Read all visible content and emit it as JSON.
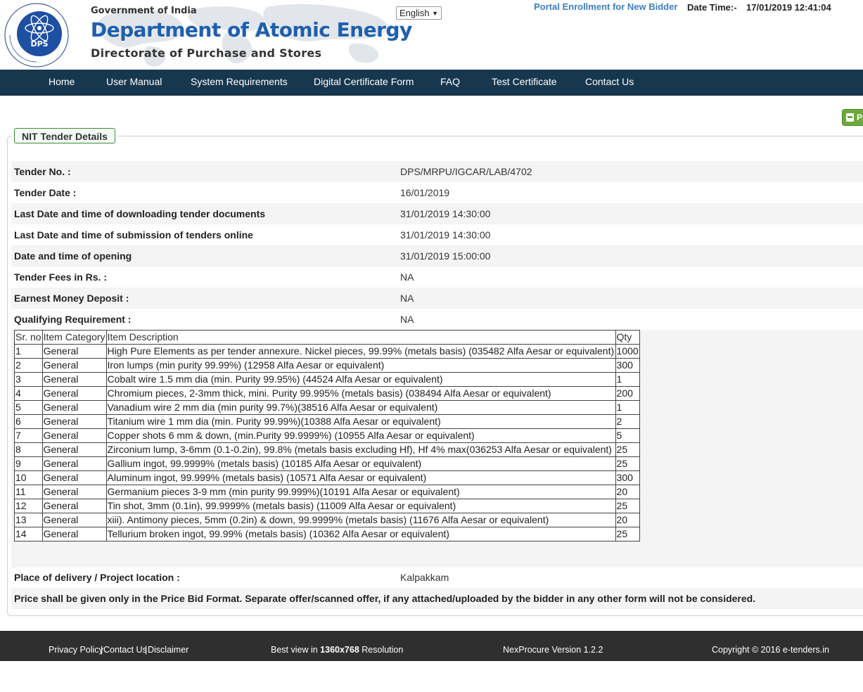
{
  "header": {
    "gov_text": "Government of India",
    "dept_title": "Department of Atomic Energy",
    "dept_subtitle": "Directorate of Purchase and Stores",
    "logo_text": "DPS",
    "language": "English",
    "portal_link": "Portal Enrollment for New Bidder",
    "datetime_label": "Date Time:-",
    "datetime_value": "17/01/2019 12:41:04"
  },
  "nav": {
    "items": [
      "Home",
      "User Manual",
      "System Requirements",
      "Digital Certificate Form",
      "FAQ",
      "Test Certificate",
      "Contact Us"
    ]
  },
  "print_button": "Pr",
  "panel": {
    "legend": "NIT Tender Details",
    "fields": [
      {
        "label": "Tender No. :",
        "value": "DPS/MRPU/IGCAR/LAB/4702"
      },
      {
        "label": "Tender Date :",
        "value": "16/01/2019"
      },
      {
        "label": "Last Date and time of downloading tender documents",
        "value": "31/01/2019 14:30:00"
      },
      {
        "label": "Last Date and time of submission of tenders online",
        "value": "31/01/2019 14:30:00"
      },
      {
        "label": "Date and time of opening",
        "value": "31/01/2019 15:00:00"
      },
      {
        "label": "Tender Fees in Rs. :",
        "value": "NA"
      },
      {
        "label": "Earnest Money Deposit :",
        "value": "NA"
      },
      {
        "label": "Qualifying Requirement :",
        "value": "NA"
      }
    ],
    "items_table": {
      "headers": [
        "Sr. no",
        "Item Category",
        "Item Description",
        "Qty"
      ],
      "rows": [
        [
          "1",
          "General",
          "High Pure Elements as per tender annexure. Nickel pieces, 99.99% (metals basis) (035482 Alfa Aesar or equivalent)",
          "1000"
        ],
        [
          "2",
          "General",
          "Iron lumps (min purity 99.99%) (12958 Alfa Aesar or equivalent)",
          "300"
        ],
        [
          "3",
          "General",
          "Cobalt wire 1.5 mm dia (min. Purity 99.95%) (44524 Alfa Aesar or equivalent)",
          "1"
        ],
        [
          "4",
          "General",
          "Chromium pieces, 2-3mm thick, mini. Purity 99.995% (metals basis) (038494 Alfa Aesar or equivalent)",
          "200"
        ],
        [
          "5",
          "General",
          "Vanadium wire 2 mm dia (min purity 99.7%)(38516 Alfa Aesar or equivalent)",
          "1"
        ],
        [
          "6",
          "General",
          "Titanium wire 1 mm dia (min. Purity 99.99%)(10388 Alfa Aesar or equivalent)",
          "2"
        ],
        [
          "7",
          "General",
          "Copper shots 6 mm & down, (min.Purity 99.9999%) (10955 Alfa Aesar or equivalent)",
          "5"
        ],
        [
          "8",
          "General",
          "Zirconium lump, 3-6mm (0.1-0.2in), 99.8% (metals basis excluding Hf), Hf 4% max(036253 Alfa Aesar or equivalent)",
          "25"
        ],
        [
          "9",
          "General",
          "Gallium ingot, 99.9999% (metals basis) (10185 Alfa Aesar or equivalent)",
          "25"
        ],
        [
          "10",
          "General",
          "Aluminum ingot, 99.999% (metals basis) (10571 Alfa Aesar or equivalent)",
          "300"
        ],
        [
          "11",
          "General",
          "Germanium pieces 3-9 mm (min purity 99.999%)(10191 Alfa Aesar or equivalent)",
          "20"
        ],
        [
          "12",
          "General",
          "Tin shot, 3mm (0.1in), 99.9999% (metals basis) (11009 Alfa Aesar or equivalent)",
          "25"
        ],
        [
          "13",
          "General",
          "xiii). Antimony pieces, 5mm (0.2in) & down, 99.9999% (metals basis) (11676 Alfa Aesar or equivalent)",
          "20"
        ],
        [
          "14",
          "General",
          "Tellurium broken ingot, 99.99% (metals basis) (10362 Alfa Aesar or equivalent)",
          "25"
        ]
      ]
    },
    "delivery": {
      "label": "Place of delivery / Project location :",
      "value": "Kalpakkam"
    },
    "note": "Price shall be given only in the Price Bid Format. Separate offer/scanned offer, if any attached/uploaded by the bidder in any other form will not be considered."
  },
  "footer": {
    "privacy": "Privacy Policy",
    "contact": "Contact Us",
    "disclaimer": "Disclaimer",
    "sep": "|",
    "best_view_prefix": "Best view in ",
    "best_view_res": "1360x768",
    "best_view_suffix": " Resolution",
    "version": "NexProcure Version 1.2.2",
    "copyright": "Copyright © 2016 e-tenders.in"
  },
  "colors": {
    "nav_bg": "#17374f",
    "footer_bg": "#2f2f2f",
    "dept_blue": "#1f5fae",
    "link_blue": "#3d7fc2",
    "print_green": "#6da83a",
    "legend_border": "#3b8a3b"
  }
}
